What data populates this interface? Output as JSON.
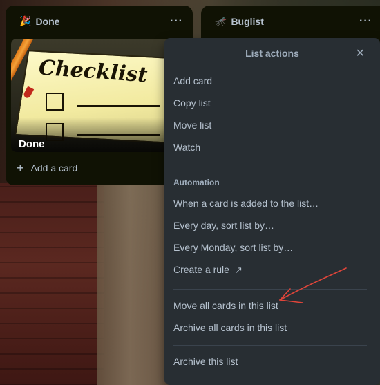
{
  "lists": [
    {
      "title": "Done",
      "emoji": "🎉",
      "menu_label": "···",
      "card": {
        "title": "Done",
        "cover_text": "Checklist"
      },
      "add_card_label": "Add a card"
    },
    {
      "title": "Buglist",
      "emoji": "🦟",
      "menu_label": "···"
    }
  ],
  "popover": {
    "title": "List actions",
    "close_label": "✕",
    "items_top": [
      "Add card",
      "Copy list",
      "Move list",
      "Watch"
    ],
    "automation_label": "Automation",
    "automation_items": [
      "When a card is added to the list…",
      "Every day, sort list by…",
      "Every Monday, sort list by…",
      "Create a rule"
    ],
    "create_rule_icon": "↗",
    "bulk_items": [
      "Move all cards in this list",
      "Archive all cards in this list"
    ],
    "archive_item": "Archive this list"
  },
  "colors": {
    "list_bg": "#101204",
    "popover_bg": "#282e33",
    "text": "#b6c2cf",
    "annotation_arrow": "#e0453a"
  }
}
